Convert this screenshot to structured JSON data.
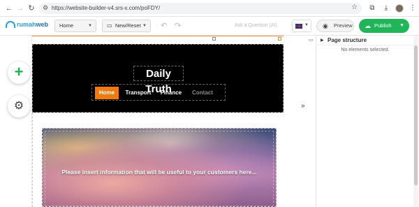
{
  "browser": {
    "url": "https://website-builder-v4.srs-x.com/poFDY/"
  },
  "toolbar": {
    "brand_prefix": "rumah",
    "brand_suffix": "web",
    "page_select": "Home",
    "new_reset": "New/Reset",
    "ask_question": "Ask a Question (AI)",
    "preview": "Preview",
    "publish": "Publish"
  },
  "site": {
    "title": "Daily Truth",
    "menu": [
      {
        "label": "Home",
        "active": true
      },
      {
        "label": "Transport",
        "active": false
      },
      {
        "label": "Finance",
        "active": false
      },
      {
        "label": "Contact",
        "active": false
      }
    ],
    "hero_message": "Please insert information that will be useful to your customers here..."
  },
  "panel": {
    "title": "Page structure",
    "empty_text": "No elements selected."
  },
  "colors": {
    "accent_orange": "#f07a0f",
    "publish_green": "#20b558",
    "brand_blue": "#2a9fd8"
  },
  "icons": [
    "back-icon",
    "forward-icon",
    "reload-icon",
    "star-icon",
    "extensions-icon",
    "download-icon",
    "plus-icon",
    "gear-icon",
    "eye-icon",
    "cloud-upload-icon",
    "chevron-double-right-icon"
  ]
}
